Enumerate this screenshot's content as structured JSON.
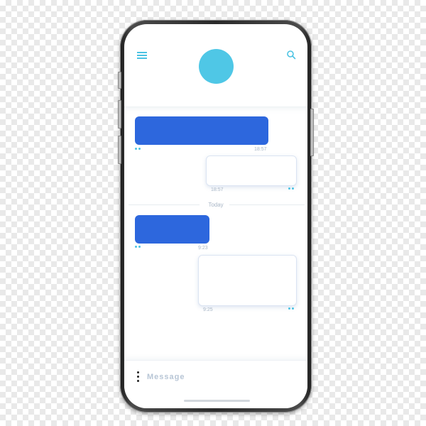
{
  "colors": {
    "accent": "#4cc3e3",
    "incoming_bubble": "#2d67dd",
    "avatar": "#4fc7e6",
    "outgoing_bubble_border": "#dbe4f2",
    "timestamp_text": "#a8b6c6"
  },
  "header": {
    "menu_icon": "hamburger-menu",
    "search_icon": "magnifier"
  },
  "conversation": {
    "messages": [
      {
        "direction": "incoming",
        "time": "18:57"
      },
      {
        "direction": "outgoing",
        "time": "18:57"
      },
      {
        "direction": "incoming",
        "time": "9:23"
      },
      {
        "direction": "outgoing",
        "time": "9:25"
      }
    ],
    "day_separator": "Today"
  },
  "composer": {
    "options_icon": "vertical-dots",
    "placeholder": "Message"
  }
}
